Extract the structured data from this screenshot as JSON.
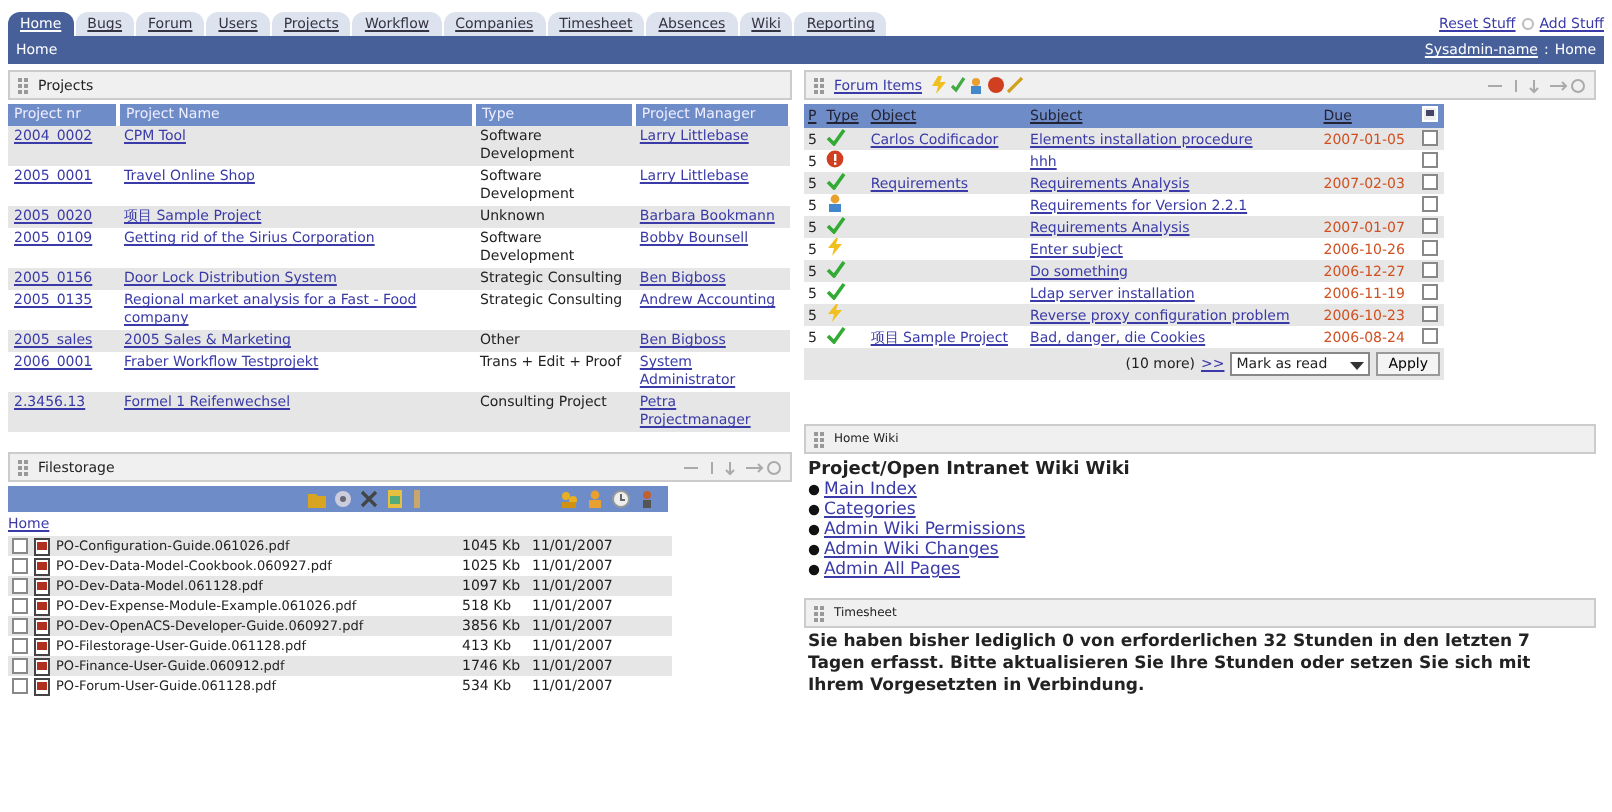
{
  "tabs": [
    {
      "label": "Home",
      "selected": true
    },
    {
      "label": "Bugs",
      "selected": false
    },
    {
      "label": "Forum",
      "selected": false
    },
    {
      "label": "Users",
      "selected": false
    },
    {
      "label": "Projects",
      "selected": false
    },
    {
      "label": "Workflow",
      "selected": false
    },
    {
      "label": "Companies",
      "selected": false
    },
    {
      "label": "Timesheet",
      "selected": false
    },
    {
      "label": "Absences",
      "selected": false
    },
    {
      "label": "Wiki",
      "selected": false
    },
    {
      "label": "Reporting",
      "selected": false
    }
  ],
  "top_links": [
    "Reset Stuff",
    "Add Stuff"
  ],
  "breadcrumb": "Home",
  "user_line": {
    "user": "Sysadmin-name",
    "separator": ":",
    "page": "Home"
  },
  "projects": {
    "title": "Projects",
    "columns": [
      "Project nr",
      "Project Name",
      "Type",
      "Project Manager"
    ],
    "rows": [
      {
        "nr": "2004_0002",
        "name": "CPM Tool",
        "type": "Software Development",
        "manager": "Larry Littlebase"
      },
      {
        "nr": "2005_0001",
        "name": "Travel Online Shop",
        "type": "Software Development",
        "manager": "Larry Littlebase"
      },
      {
        "nr": "2005_0020",
        "name": "项目 Sample Project",
        "type": "Unknown",
        "manager": "Barbara Bookmann"
      },
      {
        "nr": "2005_0109",
        "name": "Getting rid of the Sirius Corporation",
        "type": "Software Development",
        "manager": "Bobby Bounsell"
      },
      {
        "nr": "2005_0156",
        "name": "Door Lock Distribution System",
        "type": "Strategic Consulting",
        "manager": "Ben Bigboss"
      },
      {
        "nr": "2005_0135",
        "name": "Regional market analysis for a Fast - Food company",
        "type": "Strategic Consulting",
        "manager": "Andrew Accounting"
      },
      {
        "nr": "2005_sales",
        "name": "2005 Sales & Marketing",
        "type": "Other",
        "manager": "Ben Bigboss"
      },
      {
        "nr": "2006_0001",
        "name": "Fraber Workflow Testprojekt",
        "type": "Trans + Edit + Proof",
        "manager": "System Administrator"
      },
      {
        "nr": "2.3456.13",
        "name": "Formel 1 Reifenwechsel",
        "type": "Consulting Project",
        "manager": "Petra Projectmanager"
      }
    ]
  },
  "filestorage": {
    "title": "Filestorage",
    "home_link": "Home",
    "files": [
      {
        "name": "PO-Configuration-Guide.061026.pdf",
        "size": "1045 Kb",
        "date": "11/01/2007",
        "checked": false
      },
      {
        "name": "PO-Dev-Data-Model-Cookbook.060927.pdf",
        "size": "1025 Kb",
        "date": "11/01/2007",
        "checked": false
      },
      {
        "name": "PO-Dev-Data-Model.061128.pdf",
        "size": "1097 Kb",
        "date": "11/01/2007",
        "checked": false
      },
      {
        "name": "PO-Dev-Expense-Module-Example.061026.pdf",
        "size": "518 Kb",
        "date": "11/01/2007",
        "checked": false
      },
      {
        "name": "PO-Dev-OpenACS-Developer-Guide.060927.pdf",
        "size": "3856 Kb",
        "date": "11/01/2007",
        "checked": false
      },
      {
        "name": "PO-Filestorage-User-Guide.061128.pdf",
        "size": "413 Kb",
        "date": "11/01/2007",
        "checked": false
      },
      {
        "name": "PO-Finance-User-Guide.060912.pdf",
        "size": "1746 Kb",
        "date": "11/01/2007",
        "checked": false
      },
      {
        "name": "PO-Forum-User-Guide.061128.pdf",
        "size": "534 Kb",
        "date": "11/01/2007",
        "checked": false
      }
    ]
  },
  "forum": {
    "title": "Forum Items",
    "columns": [
      "P",
      "Type",
      "Object",
      "Subject",
      "Due"
    ],
    "rows": [
      {
        "p": "5",
        "kind": "done",
        "object": "Carlos Codificador",
        "subject": "Elements installation procedure",
        "due": "2007-01-05",
        "checked": false
      },
      {
        "p": "5",
        "kind": "alert",
        "subject": "hhh",
        "checked": false
      },
      {
        "p": "5",
        "kind": "done",
        "object": "Requirements",
        "subject": "Requirements Analysis",
        "due": "2007-02-03",
        "checked": false
      },
      {
        "p": "5",
        "kind": "group",
        "subject": "Requirements for Version 2.2.1",
        "checked": false
      },
      {
        "p": "5",
        "kind": "done",
        "subject": "Requirements Analysis",
        "due": "2007-01-07",
        "checked": false
      },
      {
        "p": "5",
        "kind": "idea",
        "subject": "Enter subject",
        "due": "2006-10-26",
        "checked": false
      },
      {
        "p": "5",
        "kind": "done",
        "subject": "Do something",
        "due": "2006-12-27",
        "checked": false
      },
      {
        "p": "5",
        "kind": "done",
        "subject": "Ldap server installation",
        "due": "2006-11-19",
        "checked": false
      },
      {
        "p": "5",
        "kind": "idea",
        "subject": "Reverse proxy configuration problem",
        "due": "2006-10-23",
        "checked": false
      },
      {
        "p": "5",
        "kind": "done",
        "object": "项目 Sample Project",
        "subject": "Bad, danger, die Cookies",
        "due": "2006-08-24",
        "checked": false
      }
    ],
    "more_text": "(10 more)",
    "more_link": ">>",
    "action": "Mark as read",
    "apply": "Apply"
  },
  "wiki": {
    "title": "Home Wiki",
    "heading": "Project/Open Intranet Wiki Wiki",
    "links": [
      "Main Index",
      "Categories",
      "Admin Wiki Permissions",
      "Admin Wiki Changes",
      "Admin All Pages"
    ]
  },
  "timesheet": {
    "title": "Timesheet",
    "message": "Sie haben bisher lediglich 0 von erforderlichen 32 Stunden in den letzten 7 Tagen erfasst. Bitte aktualisieren Sie Ihre Stunden oder setzen Sie sich mit Ihrem Vorgesetzten in Verbindung."
  }
}
